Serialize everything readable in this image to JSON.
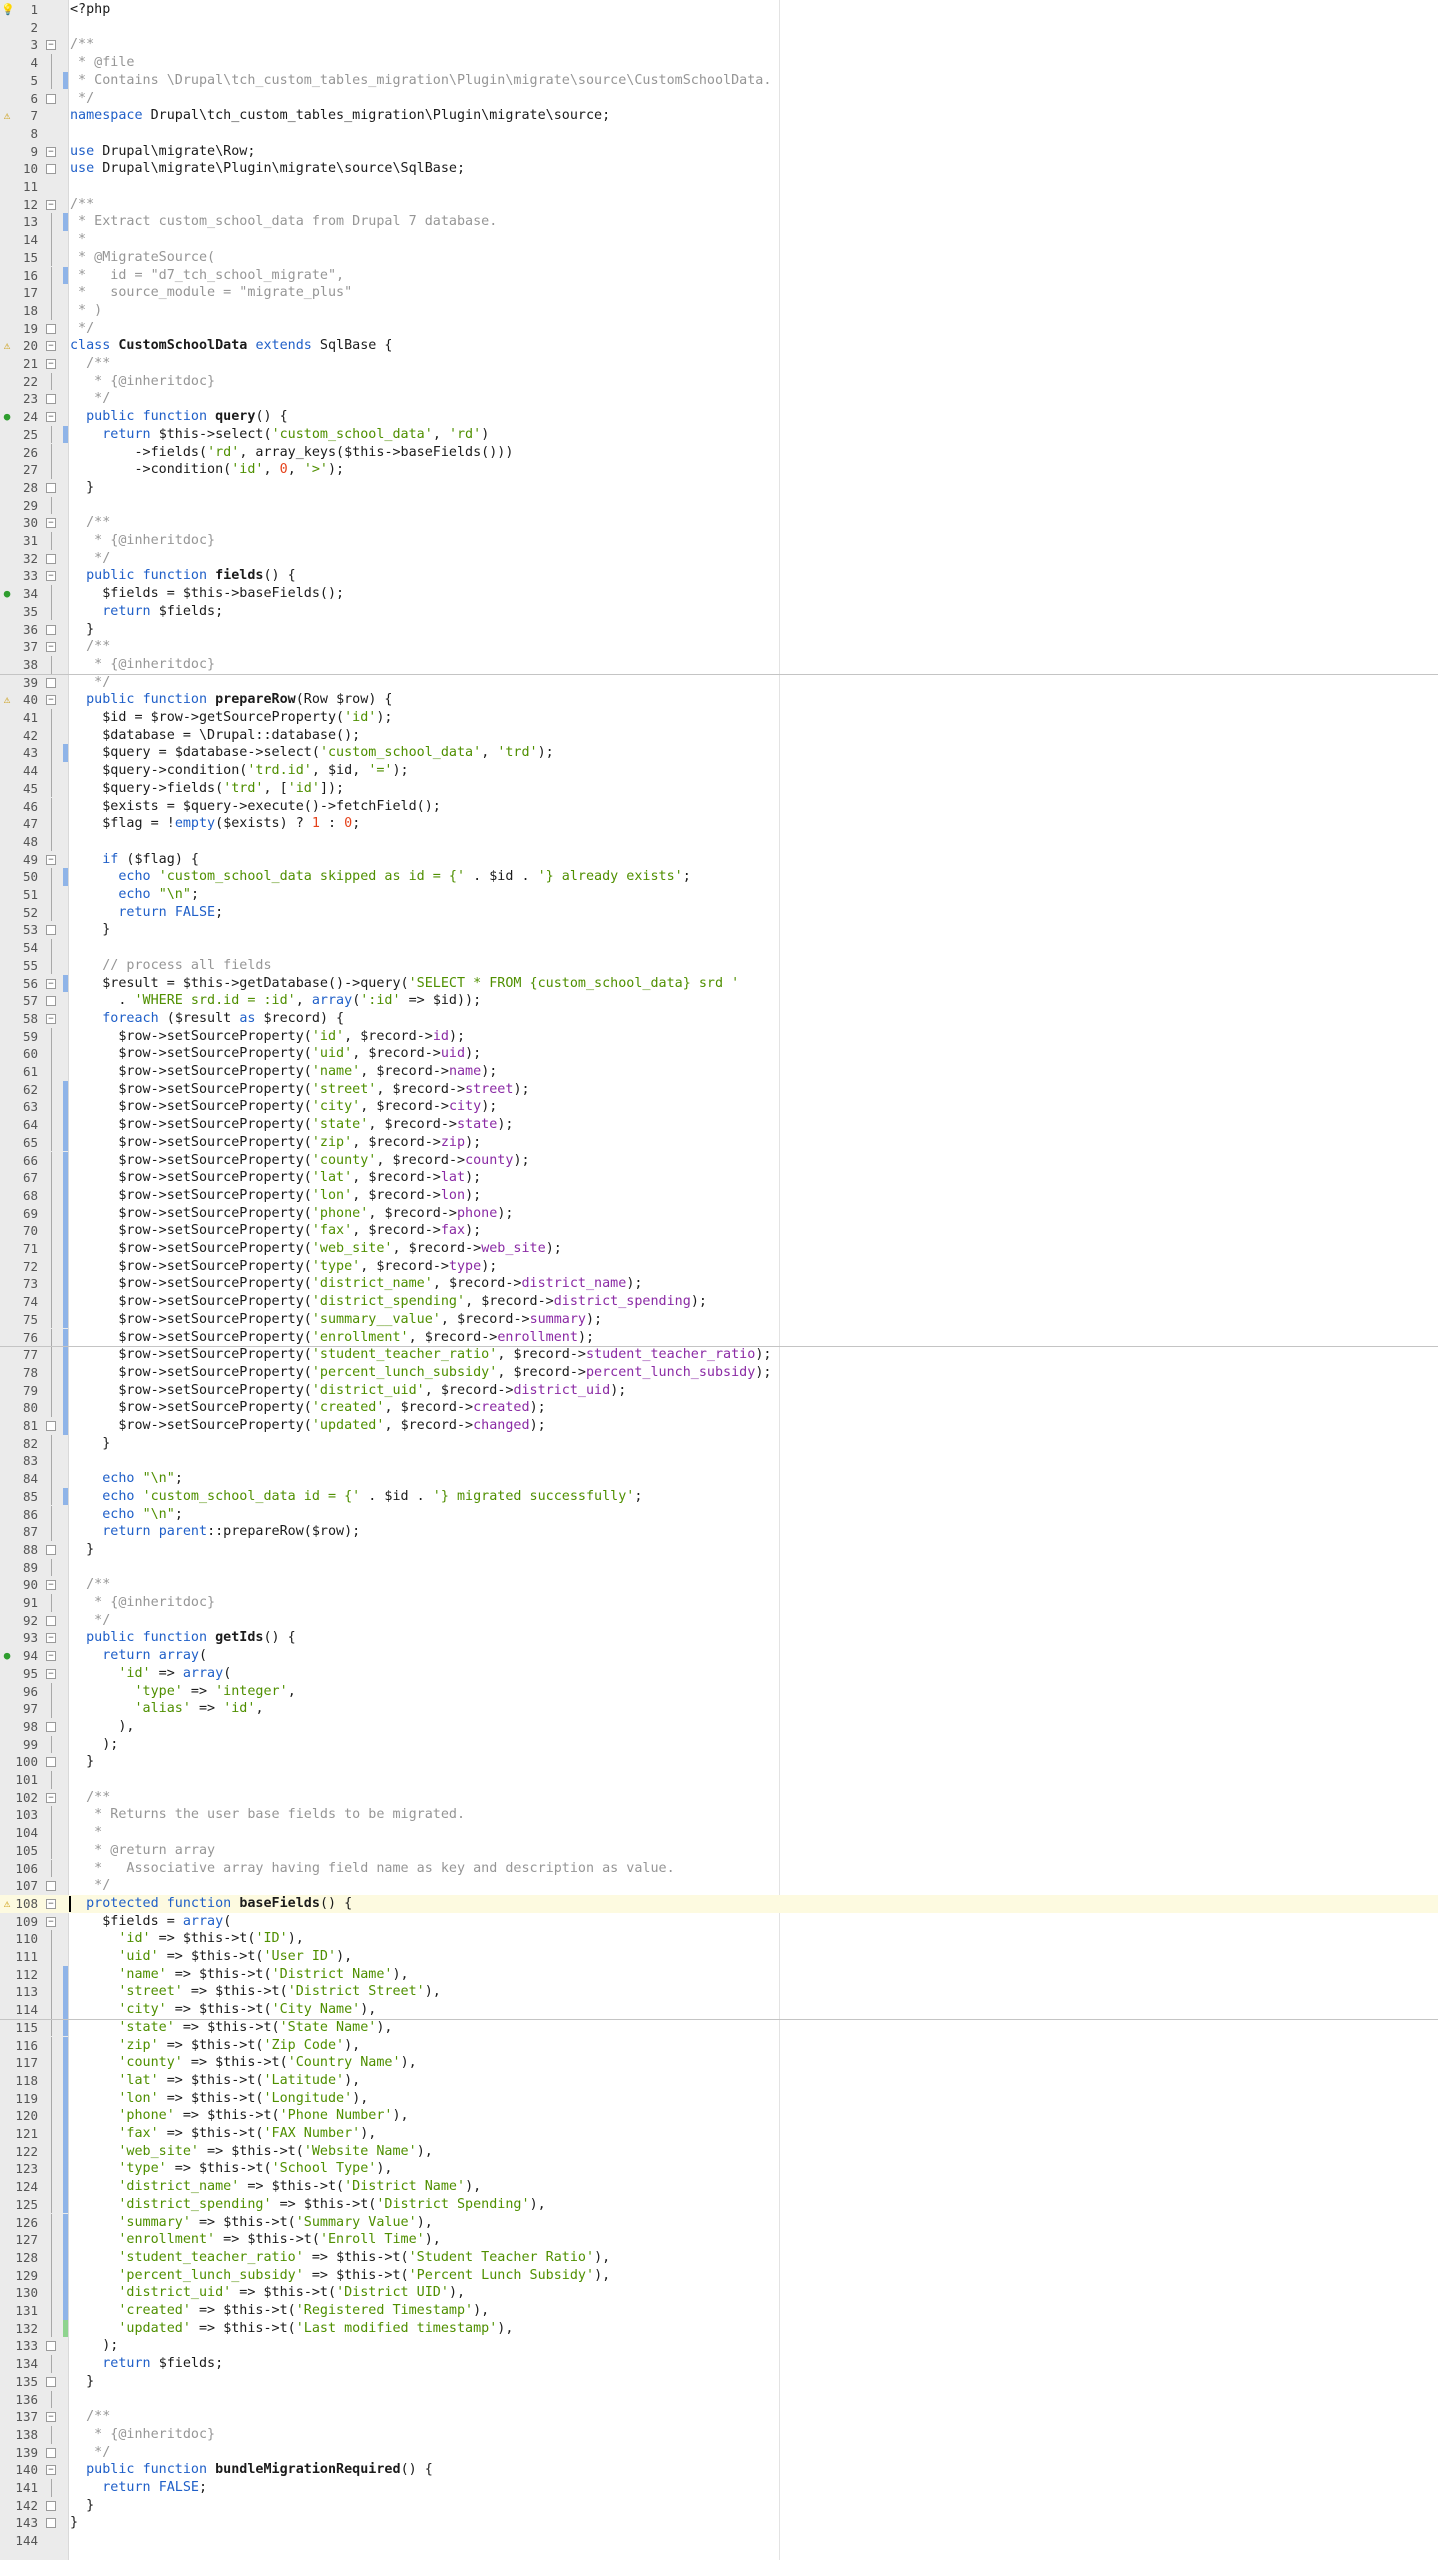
{
  "window": {
    "language": "PHP"
  },
  "editor": {
    "current_line": 108,
    "lines": [
      "<?php",
      "",
      "/**",
      " * @file",
      " * Contains \\Drupal\\tch_custom_tables_migration\\Plugin\\migrate\\source\\CustomSchoolData.",
      " */",
      "namespace Drupal\\tch_custom_tables_migration\\Plugin\\migrate\\source;",
      "",
      "use Drupal\\migrate\\Row;",
      "use Drupal\\migrate\\Plugin\\migrate\\source\\SqlBase;",
      "",
      "/**",
      " * Extract custom_school_data from Drupal 7 database.",
      " *",
      " * @MigrateSource(",
      " *   id = \"d7_tch_school_migrate\",",
      " *   source_module = \"migrate_plus\"",
      " * )",
      " */",
      "class CustomSchoolData extends SqlBase {",
      "  /**",
      "   * {@inheritdoc}",
      "   */",
      "  public function query() {",
      "    return $this->select('custom_school_data', 'rd')",
      "        ->fields('rd', array_keys($this->baseFields()))",
      "        ->condition('id', 0, '>');",
      "  }",
      "",
      "  /**",
      "   * {@inheritdoc}",
      "   */",
      "  public function fields() {",
      "    $fields = $this->baseFields();",
      "    return $fields;",
      "  }",
      "  /**",
      "   * {@inheritdoc}",
      "   */",
      "  public function prepareRow(Row $row) {",
      "    $id = $row->getSourceProperty('id');",
      "    $database = \\Drupal::database();",
      "    $query = $database->select('custom_school_data', 'trd');",
      "    $query->condition('trd.id', $id, '=');",
      "    $query->fields('trd', ['id']);",
      "    $exists = $query->execute()->fetchField();",
      "    $flag = !empty($exists) ? 1 : 0;",
      "",
      "    if ($flag) {",
      "      echo 'custom_school_data skipped as id = {' . $id . '} already exists';",
      "      echo \"\\n\";",
      "      return FALSE;",
      "    }",
      "",
      "    // process all fields",
      "    $result = $this->getDatabase()->query('SELECT * FROM {custom_school_data} srd '",
      "      . 'WHERE srd.id = :id', array(':id' => $id));",
      "    foreach ($result as $record) {",
      "      $row->setSourceProperty('id', $record->id);",
      "      $row->setSourceProperty('uid', $record->uid);",
      "      $row->setSourceProperty('name', $record->name);",
      "      $row->setSourceProperty('street', $record->street);",
      "      $row->setSourceProperty('city', $record->city);",
      "      $row->setSourceProperty('state', $record->state);",
      "      $row->setSourceProperty('zip', $record->zip);",
      "      $row->setSourceProperty('county', $record->county);",
      "      $row->setSourceProperty('lat', $record->lat);",
      "      $row->setSourceProperty('lon', $record->lon);",
      "      $row->setSourceProperty('phone', $record->phone);",
      "      $row->setSourceProperty('fax', $record->fax);",
      "      $row->setSourceProperty('web_site', $record->web_site);",
      "      $row->setSourceProperty('type', $record->type);",
      "      $row->setSourceProperty('district_name', $record->district_name);",
      "      $row->setSourceProperty('district_spending', $record->district_spending);",
      "      $row->setSourceProperty('summary__value', $record->summary);",
      "      $row->setSourceProperty('enrollment', $record->enrollment);",
      "      $row->setSourceProperty('student_teacher_ratio', $record->student_teacher_ratio);",
      "      $row->setSourceProperty('percent_lunch_subsidy', $record->percent_lunch_subsidy);",
      "      $row->setSourceProperty('district_uid', $record->district_uid);",
      "      $row->setSourceProperty('created', $record->created);",
      "      $row->setSourceProperty('updated', $record->changed);",
      "    }",
      "",
      "    echo \"\\n\";",
      "    echo 'custom_school_data id = {' . $id . '} migrated successfully';",
      "    echo \"\\n\";",
      "    return parent::prepareRow($row);",
      "  }",
      "",
      "  /**",
      "   * {@inheritdoc}",
      "   */",
      "  public function getIds() {",
      "    return array(",
      "      'id' => array(",
      "        'type' => 'integer',",
      "        'alias' => 'id',",
      "      ),",
      "    );",
      "  }",
      "",
      "  /**",
      "   * Returns the user base fields to be migrated.",
      "   *",
      "   * @return array",
      "   *   Associative array having field name as key and description as value.",
      "   */",
      "  protected function baseFields() {",
      "    $fields = array(",
      "      'id' => $this->t('ID'),",
      "      'uid' => $this->t('User ID'),",
      "      'name' => $this->t('District Name'),",
      "      'street' => $this->t('District Street'),",
      "      'city' => $this->t('City Name'),",
      "      'state' => $this->t('State Name'),",
      "      'zip' => $this->t('Zip Code'),",
      "      'county' => $this->t('Country Name'),",
      "      'lat' => $this->t('Latitude'),",
      "      'lon' => $this->t('Longitude'),",
      "      'phone' => $this->t('Phone Number'),",
      "      'fax' => $this->t('FAX Number'),",
      "      'web_site' => $this->t('Website Name'),",
      "      'type' => $this->t('School Type'),",
      "      'district_name' => $this->t('District Name'),",
      "      'district_spending' => $this->t('District Spending'),",
      "      'summary' => $this->t('Summary Value'),",
      "      'enrollment' => $this->t('Enroll Time'),",
      "      'student_teacher_ratio' => $this->t('Student Teacher Ratio'),",
      "      'percent_lunch_subsidy' => $this->t('Percent Lunch Subsidy'),",
      "      'district_uid' => $this->t('District UID'),",
      "      'created' => $this->t('Registered Timestamp'),",
      "      'updated' => $this->t('Last modified timestamp'),",
      "    );",
      "    return $fields;",
      "  }",
      "",
      "  /**",
      "   * {@inheritdoc}",
      "   */",
      "  public function bundleMigrationRequired() {",
      "    return FALSE;",
      "  }",
      "}",
      ""
    ],
    "markers": {
      "1": "bulb",
      "7": "warn",
      "20": "warn",
      "24": "info",
      "34": "info",
      "40": "warn",
      "94": "info",
      "108": "warn"
    },
    "marker_glyphs": {
      "bulb": "💡",
      "warn": "⚠",
      "info": "●"
    }
  }
}
